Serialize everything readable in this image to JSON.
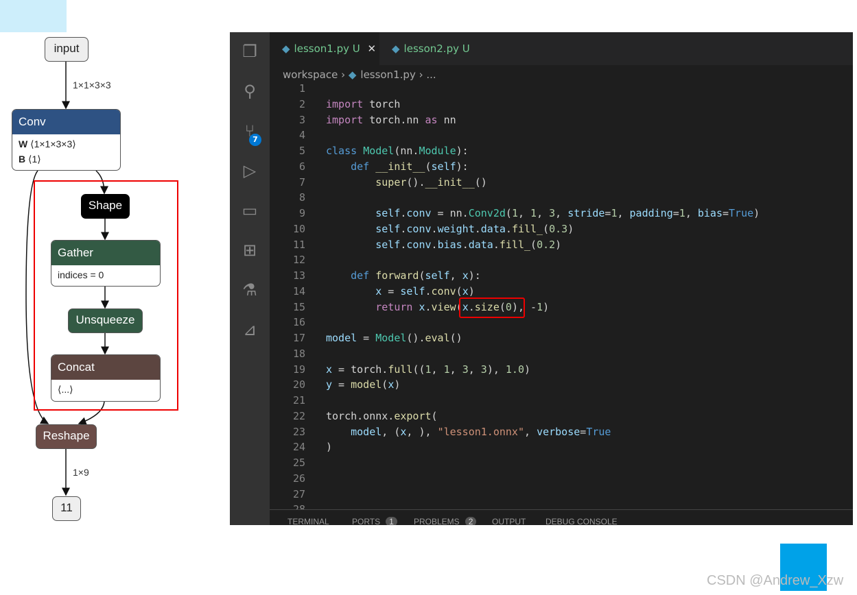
{
  "graph": {
    "nodes": {
      "input": "input",
      "conv": {
        "title": "Conv",
        "w_label": "W",
        "w_value": "⟨1×1×3×3⟩",
        "b_label": "B",
        "b_value": "⟨1⟩",
        "color": "#2e5283"
      },
      "shape": "Shape",
      "gather": {
        "title": "Gather",
        "attr": "indices = 0",
        "color": "#335a44"
      },
      "unsqueeze": "Unsqueeze",
      "concat": {
        "title": "Concat",
        "attr": "⟨...⟩",
        "color": "#5c4540"
      },
      "reshape": "Reshape",
      "output": "11"
    },
    "edge_labels": {
      "input_conv": "1×1×3×3",
      "reshape_out": "1×9"
    }
  },
  "editor": {
    "tabs": [
      {
        "label": "lesson1.py",
        "status": "U",
        "active": true
      },
      {
        "label": "lesson2.py",
        "status": "U",
        "active": false
      }
    ],
    "breadcrumb": [
      "workspace",
      "lesson1.py",
      "..."
    ],
    "source_control_badge": "7",
    "lines": [
      [],
      [
        [
          "kw",
          "import"
        ],
        [
          "pl",
          " torch"
        ]
      ],
      [
        [
          "kw",
          "import"
        ],
        [
          "pl",
          " torch.nn "
        ],
        [
          "kw",
          "as"
        ],
        [
          "pl",
          " nn"
        ]
      ],
      [],
      [
        [
          "bl",
          "class"
        ],
        [
          "pl",
          " "
        ],
        [
          "cls",
          "Model"
        ],
        [
          "pl",
          "(nn."
        ],
        [
          "cls",
          "Module"
        ],
        [
          "pl",
          "):"
        ]
      ],
      [
        [
          "pl",
          "    "
        ],
        [
          "bl",
          "def"
        ],
        [
          "pl",
          " "
        ],
        [
          "fn",
          "__init__"
        ],
        [
          "pl",
          "("
        ],
        [
          "var",
          "self"
        ],
        [
          "pl",
          "):"
        ]
      ],
      [
        [
          "pl",
          "        "
        ],
        [
          "fn",
          "super"
        ],
        [
          "pl",
          "()."
        ],
        [
          "fn",
          "__init__"
        ],
        [
          "pl",
          "()"
        ]
      ],
      [],
      [
        [
          "pl",
          "        "
        ],
        [
          "var",
          "self"
        ],
        [
          "pl",
          "."
        ],
        [
          "var",
          "conv"
        ],
        [
          "pl",
          " = nn."
        ],
        [
          "cls",
          "Conv2d"
        ],
        [
          "pl",
          "("
        ],
        [
          "num",
          "1"
        ],
        [
          "pl",
          ", "
        ],
        [
          "num",
          "1"
        ],
        [
          "pl",
          ", "
        ],
        [
          "num",
          "3"
        ],
        [
          "pl",
          ", "
        ],
        [
          "var",
          "stride"
        ],
        [
          "pl",
          "="
        ],
        [
          "num",
          "1"
        ],
        [
          "pl",
          ", "
        ],
        [
          "var",
          "padding"
        ],
        [
          "pl",
          "="
        ],
        [
          "num",
          "1"
        ],
        [
          "pl",
          ", "
        ],
        [
          "var",
          "bias"
        ],
        [
          "pl",
          "="
        ],
        [
          "bl",
          "True"
        ],
        [
          "pl",
          ")"
        ]
      ],
      [
        [
          "pl",
          "        "
        ],
        [
          "var",
          "self"
        ],
        [
          "pl",
          "."
        ],
        [
          "var",
          "conv"
        ],
        [
          "pl",
          "."
        ],
        [
          "var",
          "weight"
        ],
        [
          "pl",
          "."
        ],
        [
          "var",
          "data"
        ],
        [
          "pl",
          "."
        ],
        [
          "fn",
          "fill_"
        ],
        [
          "pl",
          "("
        ],
        [
          "num",
          "0.3"
        ],
        [
          "pl",
          ")"
        ]
      ],
      [
        [
          "pl",
          "        "
        ],
        [
          "var",
          "self"
        ],
        [
          "pl",
          "."
        ],
        [
          "var",
          "conv"
        ],
        [
          "pl",
          "."
        ],
        [
          "var",
          "bias"
        ],
        [
          "pl",
          "."
        ],
        [
          "var",
          "data"
        ],
        [
          "pl",
          "."
        ],
        [
          "fn",
          "fill_"
        ],
        [
          "pl",
          "("
        ],
        [
          "num",
          "0.2"
        ],
        [
          "pl",
          ")"
        ]
      ],
      [],
      [
        [
          "pl",
          "    "
        ],
        [
          "bl",
          "def"
        ],
        [
          "pl",
          " "
        ],
        [
          "fn",
          "forward"
        ],
        [
          "pl",
          "("
        ],
        [
          "var",
          "self"
        ],
        [
          "pl",
          ", "
        ],
        [
          "var",
          "x"
        ],
        [
          "pl",
          "):"
        ]
      ],
      [
        [
          "pl",
          "        "
        ],
        [
          "var",
          "x"
        ],
        [
          "pl",
          " = "
        ],
        [
          "var",
          "self"
        ],
        [
          "pl",
          "."
        ],
        [
          "fn",
          "conv"
        ],
        [
          "pl",
          "("
        ],
        [
          "var",
          "x"
        ],
        [
          "pl",
          ")"
        ]
      ],
      [
        [
          "pl",
          "        "
        ],
        [
          "kw",
          "return"
        ],
        [
          "pl",
          " "
        ],
        [
          "var",
          "x"
        ],
        [
          "pl",
          "."
        ],
        [
          "fn",
          "view"
        ],
        [
          "pl",
          "("
        ],
        [
          "var",
          "x"
        ],
        [
          "pl",
          "."
        ],
        [
          "fn",
          "size"
        ],
        [
          "pl",
          "("
        ],
        [
          "num",
          "0"
        ],
        [
          "pl",
          "), -"
        ],
        [
          "num",
          "1"
        ],
        [
          "pl",
          ")"
        ]
      ],
      [],
      [
        [
          "var",
          "model"
        ],
        [
          "pl",
          " = "
        ],
        [
          "cls",
          "Model"
        ],
        [
          "pl",
          "()."
        ],
        [
          "fn",
          "eval"
        ],
        [
          "pl",
          "()"
        ]
      ],
      [],
      [
        [
          "var",
          "x"
        ],
        [
          "pl",
          " = torch."
        ],
        [
          "fn",
          "full"
        ],
        [
          "pl",
          "(("
        ],
        [
          "num",
          "1"
        ],
        [
          "pl",
          ", "
        ],
        [
          "num",
          "1"
        ],
        [
          "pl",
          ", "
        ],
        [
          "num",
          "3"
        ],
        [
          "pl",
          ", "
        ],
        [
          "num",
          "3"
        ],
        [
          "pl",
          "), "
        ],
        [
          "num",
          "1.0"
        ],
        [
          "pl",
          ")"
        ]
      ],
      [
        [
          "var",
          "y"
        ],
        [
          "pl",
          " = "
        ],
        [
          "fn",
          "model"
        ],
        [
          "pl",
          "("
        ],
        [
          "var",
          "x"
        ],
        [
          "pl",
          ")"
        ]
      ],
      [],
      [
        [
          "pl",
          "torch.onnx."
        ],
        [
          "fn",
          "export"
        ],
        [
          "pl",
          "("
        ]
      ],
      [
        [
          "pl",
          "    "
        ],
        [
          "var",
          "model"
        ],
        [
          "pl",
          ", ("
        ],
        [
          "var",
          "x"
        ],
        [
          "pl",
          ", ), "
        ],
        [
          "str",
          "\"lesson1.onnx\""
        ],
        [
          "pl",
          ", "
        ],
        [
          "var",
          "verbose"
        ],
        [
          "pl",
          "="
        ],
        [
          "bl",
          "True"
        ]
      ],
      [
        [
          "pl",
          ")"
        ]
      ],
      [],
      [],
      [],
      []
    ],
    "panel_tabs": [
      {
        "label": "TERMINAL"
      },
      {
        "label": "PORTS",
        "badge": "1"
      },
      {
        "label": "PROBLEMS",
        "badge": "2"
      },
      {
        "label": "OUTPUT"
      },
      {
        "label": "DEBUG CONSOLE"
      }
    ]
  },
  "watermark": "CSDN @Andrew_Xzw",
  "colors": {
    "highlight": "#e00000",
    "accent_block": "#00a2e8"
  }
}
